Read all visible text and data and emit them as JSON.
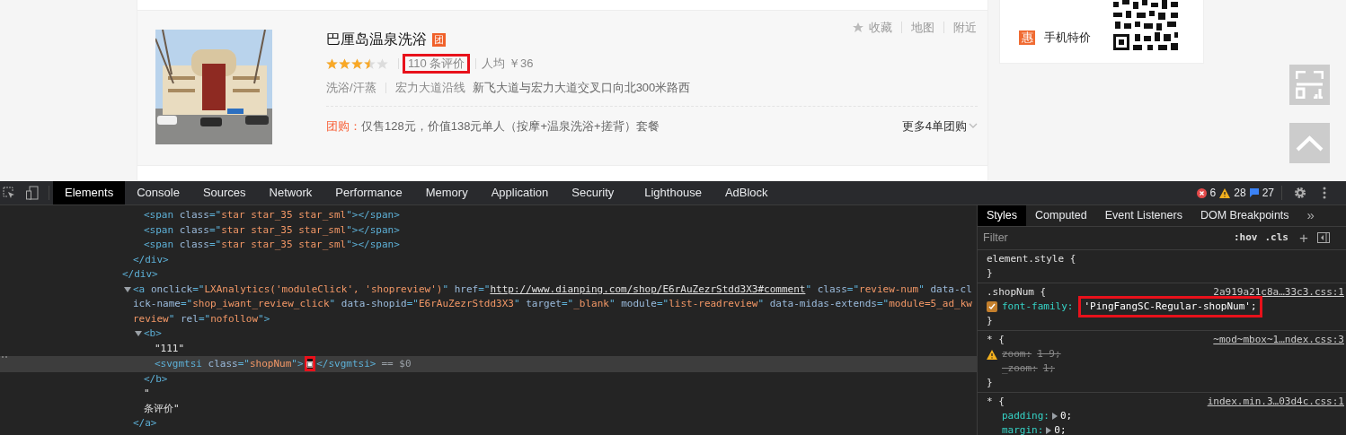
{
  "listing": {
    "title": "巴厘岛温泉洗浴",
    "tag": "团",
    "stars": 3.5,
    "review_count": {
      "text": "110 条评价",
      "highlighted": true
    },
    "price": "人均 ￥36",
    "category": "洗浴/汗蒸",
    "area": "宏力大道沿线",
    "address": "新飞大道与宏力大道交叉口向北300米路西",
    "deal_label": "团购：",
    "deal_text": "仅售128元，价值138元单人（按摩+温泉洗浴+搓背）套餐",
    "more_deals": "更多4单团购",
    "actions": [
      "收藏",
      "地图",
      "附近"
    ]
  },
  "side_panel": {
    "badge": "惠",
    "label": "手机特价"
  },
  "devtools": {
    "tabs": [
      {
        "label": "Elements",
        "selected": true
      },
      {
        "label": "Console",
        "selected": false
      },
      {
        "label": "Sources",
        "selected": false
      },
      {
        "label": "Network",
        "selected": false
      },
      {
        "label": "Performance",
        "selected": false
      },
      {
        "label": "Memory",
        "selected": false
      },
      {
        "label": "Application",
        "selected": false
      },
      {
        "label": "Security",
        "selected": false
      },
      {
        "label": "Lighthouse",
        "selected": false
      },
      {
        "label": "AdBlock",
        "selected": false
      }
    ],
    "errors": "6",
    "warnings": "28",
    "messages": "27",
    "dom": [
      {
        "children": [
          {
            "children": [
              {
                "parts": [
                  {
                    "kind": "tag",
                    "text": "<span "
                  },
                  {
                    "kind": "attr",
                    "text": "class"
                  },
                  {
                    "kind": "tag",
                    "text": "=\""
                  },
                  {
                    "kind": "value",
                    "text": "star star_35 star_sml"
                  },
                  {
                    "kind": "tag",
                    "text": "\"></span>"
                  }
                ]
              },
              {
                "parts": [
                  {
                    "kind": "tag",
                    "text": "<span "
                  },
                  {
                    "kind": "attr",
                    "text": "class"
                  },
                  {
                    "kind": "tag",
                    "text": "=\""
                  },
                  {
                    "kind": "value",
                    "text": "star star_35 star_sml"
                  },
                  {
                    "kind": "tag",
                    "text": "\"></span>"
                  }
                ]
              },
              {
                "parts": [
                  {
                    "kind": "tag",
                    "text": "<span "
                  },
                  {
                    "kind": "attr",
                    "text": "class"
                  },
                  {
                    "kind": "tag",
                    "text": "=\""
                  },
                  {
                    "kind": "value",
                    "text": "star star_35 star_sml"
                  },
                  {
                    "kind": "tag",
                    "text": "\"></span>"
                  }
                ]
              }
            ],
            "close": "</div>"
          }
        ],
        "close": "</div>"
      },
      {
        "expanded": true,
        "parts": [
          {
            "kind": "tag",
            "text": "<a "
          },
          {
            "kind": "attr",
            "text": "onclick"
          },
          {
            "kind": "tag",
            "text": "=\""
          },
          {
            "kind": "value",
            "text": "LXAnalytics('moduleClick', 'shopreview')"
          },
          {
            "kind": "tag",
            "text": "\" "
          },
          {
            "kind": "attr",
            "text": "href"
          },
          {
            "kind": "tag",
            "text": "=\""
          },
          {
            "kind": "link",
            "text": "http://www.dianping.com/shop/E6rAuZezrStdd3X3#comment"
          },
          {
            "kind": "tag",
            "text": "\" "
          },
          {
            "kind": "attr",
            "text": "class"
          },
          {
            "kind": "tag",
            "text": "=\""
          },
          {
            "kind": "value",
            "text": "review-num"
          },
          {
            "kind": "tag",
            "text": "\" "
          },
          {
            "kind": "attr",
            "text": "data-click-name"
          },
          {
            "kind": "tag",
            "text": "=\""
          },
          {
            "kind": "value",
            "text": "shop_iwant_review_click"
          },
          {
            "kind": "tag",
            "text": "\" "
          },
          {
            "kind": "attr",
            "text": "data-shopid"
          },
          {
            "kind": "tag",
            "text": "=\""
          },
          {
            "kind": "value",
            "text": "E6rAuZezrStdd3X3"
          },
          {
            "kind": "tag",
            "text": "\" "
          },
          {
            "kind": "attr",
            "text": "target"
          },
          {
            "kind": "tag",
            "text": "=\""
          },
          {
            "kind": "value",
            "text": "_blank"
          },
          {
            "kind": "tag",
            "text": "\" "
          },
          {
            "kind": "attr",
            "text": "module"
          },
          {
            "kind": "tag",
            "text": "=\""
          },
          {
            "kind": "value",
            "text": "list-readreview"
          },
          {
            "kind": "tag",
            "text": "\" "
          },
          {
            "kind": "attr",
            "text": "data-midas-extends"
          },
          {
            "kind": "tag",
            "text": "=\""
          },
          {
            "kind": "value",
            "text": "module=5_ad_kwreview"
          },
          {
            "kind": "tag",
            "text": "\" "
          },
          {
            "kind": "attr",
            "text": "rel"
          },
          {
            "kind": "tag",
            "text": "=\""
          },
          {
            "kind": "value",
            "text": "nofollow"
          },
          {
            "kind": "tag",
            "text": "\">"
          }
        ],
        "children": [
          {
            "expanded": true,
            "parts": [
              {
                "kind": "tag",
                "text": "<b>"
              }
            ],
            "children": [
              {
                "parts": [
                  {
                    "kind": "text",
                    "text": "\"111\""
                  }
                ]
              },
              {
                "selected": true,
                "parts": [
                  {
                    "kind": "tag",
                    "text": "<svgmtsi "
                  },
                  {
                    "kind": "attr",
                    "text": "class"
                  },
                  {
                    "kind": "tag",
                    "text": "=\""
                  },
                  {
                    "kind": "value",
                    "text": "shopNum"
                  },
                  {
                    "kind": "tag",
                    "text": "\">"
                  },
                  {
                    "kind": "glyph",
                    "text": "▣"
                  },
                  {
                    "kind": "tag",
                    "text": "</svgmtsi>"
                  }
                ],
                "marker": "== $0"
              }
            ],
            "close": "</b>"
          },
          {
            "parts": [
              {
                "kind": "text",
                "text": "\"\n条评价\""
              }
            ]
          }
        ],
        "close": "</a>"
      }
    ],
    "styles_tabs": [
      {
        "label": "Styles",
        "selected": true
      },
      {
        "label": "Computed",
        "selected": false
      },
      {
        "label": "Event Listeners",
        "selected": false
      },
      {
        "label": "DOM Breakpoints",
        "selected": false
      }
    ],
    "styles_more": "»",
    "filter": {
      "placeholder": "Filter"
    },
    "hov": ":hov",
    "cls": ".cls",
    "add": "+",
    "rules": [
      {
        "selector": "element.style {",
        "close": "}"
      },
      {
        "selector": ".shopNum {",
        "source": "2a919a21c8a…33c3.css:1",
        "props": [
          {
            "kind": "checkbox",
            "checked": true,
            "name": "font-family:",
            "value": "'PingFangSC-Regular-shopNum';",
            "highlighted": true
          }
        ],
        "close": "}"
      },
      {
        "selector": "* {",
        "source": "~mod~mbox~1…ndex.css:3",
        "props": [
          {
            "kind": "warning",
            "name": "zoom:",
            "value": "1 9;",
            "struck": true
          },
          {
            "kind": "plain",
            "name": "_zoom:",
            "value": "1;",
            "struck": true
          }
        ],
        "close": "}"
      },
      {
        "selector": "* {",
        "source": "index.min.3…03d4c.css:1",
        "props": [
          {
            "kind": "expandable",
            "name": "padding:",
            "value": "0;",
            "struck": false
          },
          {
            "kind": "expandable",
            "name": "margin:",
            "value": "0;",
            "struck": false
          }
        ]
      }
    ]
  }
}
